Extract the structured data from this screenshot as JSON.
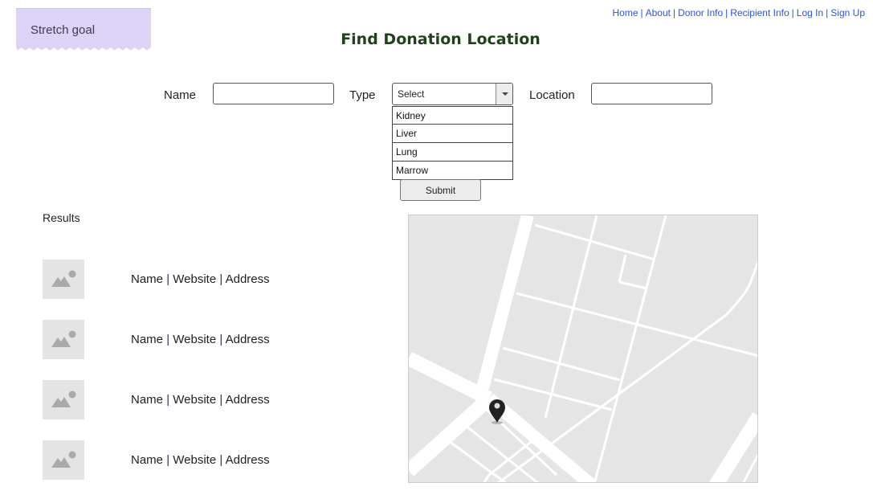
{
  "sticky_note": {
    "label": "Stretch goal",
    "color": "#dcd3f7"
  },
  "nav": {
    "links": [
      "Home",
      "About",
      "Donor Info",
      "Recipient Info",
      "Log In",
      "Sign Up"
    ],
    "separator": "|",
    "color": "#2a55d8"
  },
  "header": {
    "title": "Find Donation Location",
    "title_color": "#21401c"
  },
  "form": {
    "name": {
      "label": "Name",
      "value": "",
      "placeholder": ""
    },
    "type": {
      "label": "Type",
      "selected": "Select",
      "options": [
        "Kidney",
        "Liver",
        "Lung",
        "Marrow"
      ]
    },
    "location": {
      "label": "Location",
      "value": "",
      "placeholder": ""
    },
    "submit_label": "Submit"
  },
  "results": {
    "title": "Results",
    "items": [
      {
        "name": "Name",
        "website": "Website",
        "address": "Address",
        "image": "image-placeholder-icon"
      },
      {
        "name": "Name",
        "website": "Website",
        "address": "Address",
        "image": "image-placeholder-icon"
      },
      {
        "name": "Name",
        "website": "Website",
        "address": "Address",
        "image": "image-placeholder-icon"
      },
      {
        "name": "Name",
        "website": "Website",
        "address": "Address",
        "image": "image-placeholder-icon"
      }
    ],
    "separator": "|"
  },
  "map": {
    "marker_icon": "map-pin-icon",
    "background": "#e5e5e5",
    "road_color": "#ffffff"
  }
}
